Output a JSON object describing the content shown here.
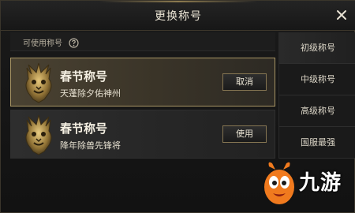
{
  "dialog": {
    "title": "更换称号",
    "close_icon": "close-icon"
  },
  "section": {
    "label": "可使用称号",
    "help_icon": "question-circle-icon"
  },
  "titles": [
    {
      "name": "春节称号",
      "description": "天蓬除夕佑神州",
      "button_label": "取消",
      "selected": true,
      "emblem_icon": "golden-lion-emblem-icon"
    },
    {
      "name": "春节称号",
      "description": "降年除兽先锋将",
      "button_label": "使用",
      "selected": false,
      "emblem_icon": "golden-lion-emblem-icon"
    }
  ],
  "side_tabs": [
    {
      "label": "初级称号"
    },
    {
      "label": "中级称号"
    },
    {
      "label": "高级称号"
    },
    {
      "label": "国服最强"
    }
  ],
  "watermark": {
    "text": "九游",
    "icon": "orange-mascot-icon"
  },
  "colors": {
    "gold_border": "#a89564",
    "background": "#141414",
    "text": "#ece6d6",
    "brand_orange": "#f07a1e"
  }
}
